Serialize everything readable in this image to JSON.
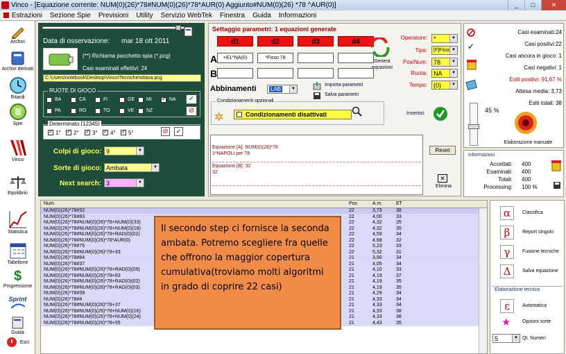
{
  "window": {
    "title": "Vinco - [Equazione corrente: NUM(0)(26)*78#NUM(0)(26)*78*AUR(0) Aggiunto#NUM(0)(26) *78 ^AUR(0)]"
  },
  "menu": [
    "Estrazioni",
    "Sezione Spie",
    "Previsioni",
    "Utility",
    "Servizio WebTek",
    "Finestra",
    "Guida",
    "Informazioni"
  ],
  "sidebar": [
    "Archivi",
    "Archivi derivati",
    "Ritardi",
    "Spie",
    "Vinco",
    "Equilibrio",
    "Statistica",
    "Tabellone",
    "Progressione",
    "Sprint",
    "Guida",
    "Esci"
  ],
  "observation": {
    "label": "Data di osservazione:",
    "date": "mar 18 ott 2011",
    "pack_text": "(**) Richiama pacchetto spia (*.pcg)",
    "examined": "Casi esaminati effettivi: 24",
    "path": "C:\\Users\\notebook\\Desktop\\Vinco\\Tecniche\\ottava.pcg"
  },
  "ruote": {
    "title": "RUOTE DI GIOCO",
    "row1": [
      "BA",
      "CA",
      "FI",
      "GE",
      "MI",
      "NA"
    ],
    "row2": [
      "PA",
      "RO",
      "TO",
      "VE",
      "NZ"
    ],
    "checked": "NA"
  },
  "determinato": {
    "title": "Determinato [12345]",
    "items": [
      "1°",
      "2°",
      "3°",
      "4°",
      "5°"
    ]
  },
  "colpi": {
    "label": "Colpi di gioco:",
    "value": "9"
  },
  "sorte": {
    "label": "Sorte di gioco:",
    "value": "Ambata"
  },
  "next": {
    "label": "Next search:",
    "value": "3"
  },
  "settaggio": {
    "title": "Settaggio parametri: 1 equazioni generate",
    "headers": [
      "d1",
      "d2",
      "d3",
      "d4"
    ],
    "rowA_label": "A",
    "rowB_label": "B",
    "rowA": [
      "+E1^NA(0)",
      "*Fisso 78",
      "",
      ""
    ],
    "genera": "Genera equazioni",
    "abbinamenti": "Abbinamenti",
    "lab": "LAB",
    "importa": "Importa parametri",
    "salva": "Salva parametri",
    "cond_title": "Condizionamenti opzionali",
    "cond_text": "Condizionamenti disattivati",
    "inserisci": "Inserisci"
  },
  "operatori": {
    "operatore": {
      "label": "Operatore:",
      "value": "*"
    },
    "tipo": {
      "label": "Tipo:",
      "value": "[F]Fisso"
    },
    "posnum": {
      "label": "Pos/Num:",
      "value": "78"
    },
    "ruota": {
      "label": "Ruota:",
      "value": "NA"
    },
    "tempo": {
      "label": "Tempo:",
      "value": "(0)"
    }
  },
  "equazioni": {
    "lineA1": "Equazione [A]: NUM(0)(26)*78",
    "lineA2": "1*NAPOLI  per 78",
    "lineB1": "Equazione [B]: 32",
    "lineB2": "32",
    "reset": "Reset",
    "elimina": "Elimina"
  },
  "stats": {
    "casi_esaminati": "Casi esaminati:24",
    "casi_positivi": "Casi positivi:22",
    "casi_gioco": "Casi ancora in gioco: 1",
    "casi_negativi": "Casi negativi: 1",
    "esiti_positivi": "Esiti positivi: 91,67 %",
    "attesa": "Attesa media: 3,73",
    "esiti_totali": "Esiti totali: 38",
    "percent": "45 %",
    "elaborazione": "Elaborazione manuale"
  },
  "info": {
    "title": "Informazioni",
    "accettati_label": "Accettati:",
    "accettati": "400",
    "esaminati_label": "Esaminati:",
    "esaminati": "400",
    "totali_label": "Totali:",
    "totali": "400",
    "processing_label": "Processing:",
    "processing": "100 %"
  },
  "table": {
    "headers": [
      "Num",
      "Pos",
      "A.m.",
      "ET"
    ],
    "rows": [
      [
        "NUM(0)(26)*78#32",
        "22",
        "3,73",
        "38"
      ],
      [
        "NUM(0)(26)*78#83",
        "22",
        "4,00",
        "33"
      ],
      [
        "NUM(0)(26)*78#NUM(0)(26)*78+NUM(0)(33)",
        "22",
        "4,32",
        "35"
      ],
      [
        "NUM(0)(26)*78#NUM(0)(26)*78+NUM(0)(18)",
        "22",
        "4,32",
        "35"
      ],
      [
        "NUM(0)(26)*78#NUM(0)(26)*78+RAD(0)(02)",
        "22",
        "4,59",
        "34"
      ],
      [
        "NUM(0)(26)*78#NUM(0)(26)*78*AUR(0)",
        "22",
        "4,68",
        "32"
      ],
      [
        "NUM(0)(26)*78#75",
        "22",
        "5,23",
        "33"
      ],
      [
        "NUM(0)(26)*78#NUM(0)(26)*78+33",
        "22",
        "5,32",
        "31"
      ],
      [
        "NUM(0)(26)*78#64",
        "21",
        "3,90",
        "34"
      ],
      [
        "NUM(0)(26)*78#37",
        "21",
        "4,05",
        "34"
      ],
      [
        "NUM(0)(26)*78#NUM(0)(26)*78+RAD(0)(09)",
        "21",
        "4,10",
        "33"
      ],
      [
        "NUM(0)(26)*78#NUM(0)(26)*78+83",
        "21",
        "4,19",
        "37"
      ],
      [
        "NUM(0)(26)*78#NUM(0)(26)*78+RAD(0)(02)",
        "21",
        "4,19",
        "35"
      ],
      [
        "NUM(0)(26)*78#NUM(0)(26)*78+RAD(0)(03)",
        "21",
        "4,19",
        "35"
      ],
      [
        "NUM(0)(26)*78#39",
        "21",
        "4,29",
        "34"
      ],
      [
        "NUM(0)(26)*78#4",
        "21",
        "4,33",
        "34"
      ],
      [
        "NUM(0)(26)*78#NUM(0)(26)*78+37",
        "21",
        "4,33",
        "34"
      ],
      [
        "NUM(0)(26)*78#NUM(0)(26)*78+NUM(0)(16)",
        "21",
        "4,33",
        "38"
      ],
      [
        "NUM(0)(26)*78#NUM(0)(26)*78+NUM(0)(24)",
        "21",
        "4,33",
        "38"
      ],
      [
        "NUM(0)(26)*78#NUM(0)(26)*78+55",
        "21",
        "4,43",
        "35"
      ]
    ]
  },
  "tools": {
    "classifica": "Classifica",
    "report": "Report singolo",
    "fusione": "Fusione tecniche",
    "salva": "Salva equazione",
    "elab_title": "Elaborazione tecnica",
    "automatica": "Automatica",
    "opzioni": "Opzioni sorte",
    "qt_value": "5",
    "qt_label": "Qt. Numeri"
  },
  "note": "Il secondo step ci fornisce la seconda ambata. Potremo scegliere fra quelle che offrono la maggior copertura cumulativa(troviamo molti algoritmi in grado di coprire 22 casi)"
}
